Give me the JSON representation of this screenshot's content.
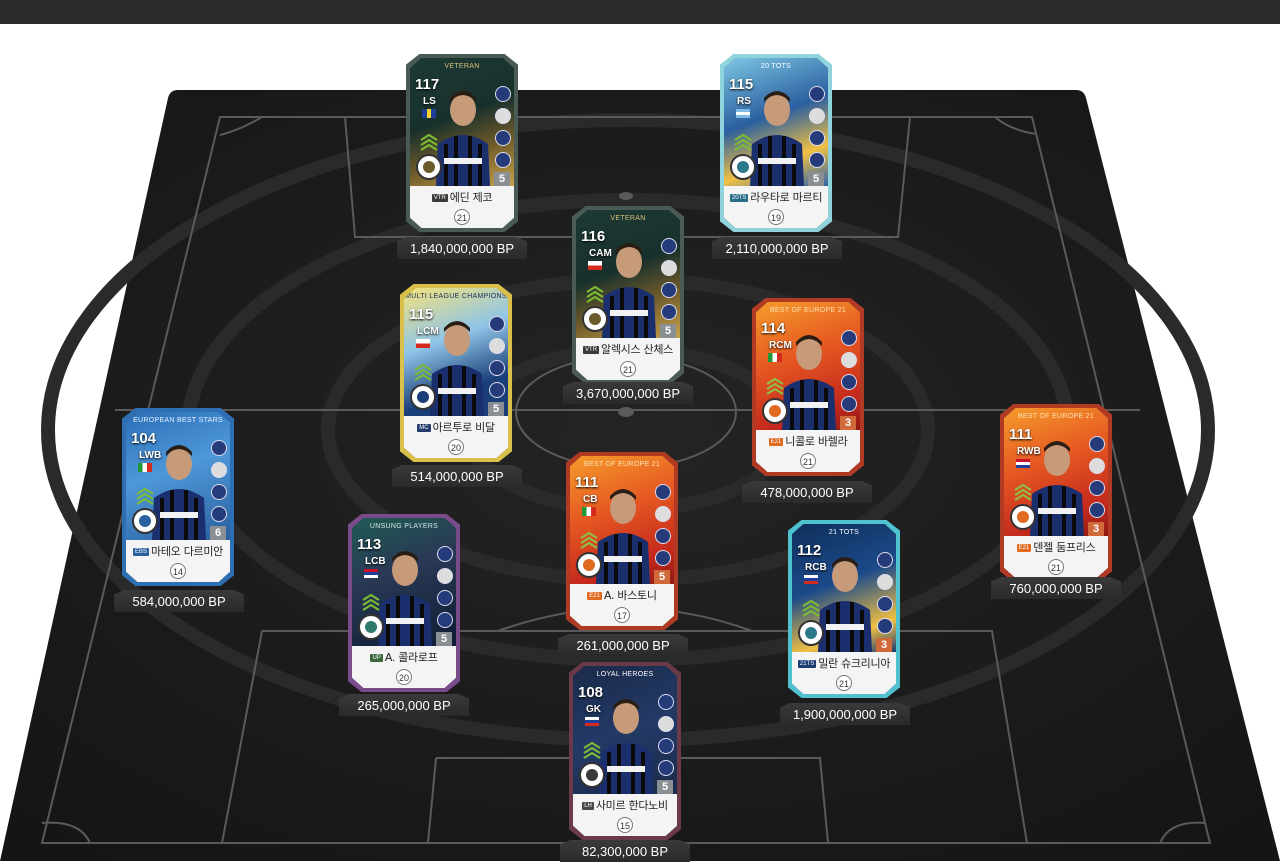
{
  "colors": {
    "page_bg": "#ffffff",
    "topbar": "#2b2b2b",
    "pitch": "#1b1b1b",
    "pitch_line": "#5a5a5a",
    "price_text": "#ffffff"
  },
  "players": [
    {
      "key": "dzeko",
      "ovr": "117",
      "position": "LS",
      "season": "VETERAN",
      "season_tag": "VTR",
      "name": "에딘 제코",
      "grade": "21",
      "level": "5",
      "price": "1,840,000,000 BP",
      "theme": "veteran",
      "flag": "bih",
      "emblem": "vtr"
    },
    {
      "key": "lautaro",
      "ovr": "115",
      "position": "RS",
      "season": "20 TOTS",
      "season_tag": "20TS",
      "name": "라우타로 마르티",
      "grade": "19",
      "level": "5",
      "price": "2,110,000,000 BP",
      "theme": "tots20",
      "flag": "arg",
      "emblem": "tots"
    },
    {
      "key": "sanchez",
      "ovr": "116",
      "position": "CAM",
      "season": "VETERAN",
      "season_tag": "VTR",
      "name": "알렉시스 산체스",
      "grade": "21",
      "level": "5",
      "price": "3,670,000,000 BP",
      "theme": "veteran",
      "flag": "chi",
      "emblem": "vtr"
    },
    {
      "key": "vidal",
      "ovr": "115",
      "position": "LCM",
      "season": "MULTI LEAGUE CHAMPIONS",
      "season_tag": "MC",
      "name": "아르투로 비달",
      "grade": "20",
      "level": "5",
      "price": "514,000,000 BP",
      "theme": "mc",
      "flag": "chi",
      "emblem": "mc"
    },
    {
      "key": "barella",
      "ovr": "114",
      "position": "RCM",
      "season": "BEST OF EUROPE 21",
      "season_tag": "E21",
      "name": "니콜로 바렐라",
      "grade": "21",
      "level": "3",
      "price": "478,000,000 BP",
      "theme": "boe",
      "flag": "ita",
      "emblem": "boe"
    },
    {
      "key": "darmian",
      "ovr": "104",
      "position": "LWB",
      "season": "EUROPEAN BEST STARS",
      "season_tag": "EBS",
      "name": "마테오 다르미안",
      "grade": "14",
      "level": "6",
      "price": "584,000,000 BP",
      "theme": "ebs",
      "flag": "ita",
      "emblem": "ebs"
    },
    {
      "key": "bastoni",
      "ovr": "111",
      "position": "CB",
      "season": "BEST OF EUROPE 21",
      "season_tag": "E21",
      "name": "A. 바스토니",
      "grade": "17",
      "level": "5",
      "price": "261,000,000 BP",
      "theme": "boe",
      "flag": "ita",
      "emblem": "boe"
    },
    {
      "key": "dumfries",
      "ovr": "111",
      "position": "RWB",
      "season": "BEST OF EUROPE 21",
      "season_tag": "E21",
      "name": "덴젤 둠프리스",
      "grade": "21",
      "level": "3",
      "price": "760,000,000 BP",
      "theme": "boe",
      "flag": "ned",
      "emblem": "boe"
    },
    {
      "key": "kolarov",
      "ovr": "113",
      "position": "LCB",
      "season": "UNSUNG PLAYERS",
      "season_tag": "UP",
      "name": "A. 콜라로프",
      "grade": "20",
      "level": "5",
      "price": "265,000,000 BP",
      "theme": "up",
      "flag": "srb",
      "emblem": "up"
    },
    {
      "key": "skriniar",
      "ovr": "112",
      "position": "RCB",
      "season": "21 TOTS",
      "season_tag": "21TS",
      "name": "밀란 슈크리니아",
      "grade": "21",
      "level": "3",
      "price": "1,900,000,000 BP",
      "theme": "tots21",
      "flag": "svk",
      "emblem": "tots"
    },
    {
      "key": "handanovic",
      "ovr": "108",
      "position": "GK",
      "season": "LOYAL HEROES",
      "season_tag": "LH",
      "name": "사미르 한다노비",
      "grade": "15",
      "level": "5",
      "price": "82,300,000 BP",
      "theme": "lh",
      "flag": "svn",
      "emblem": "lh"
    }
  ]
}
